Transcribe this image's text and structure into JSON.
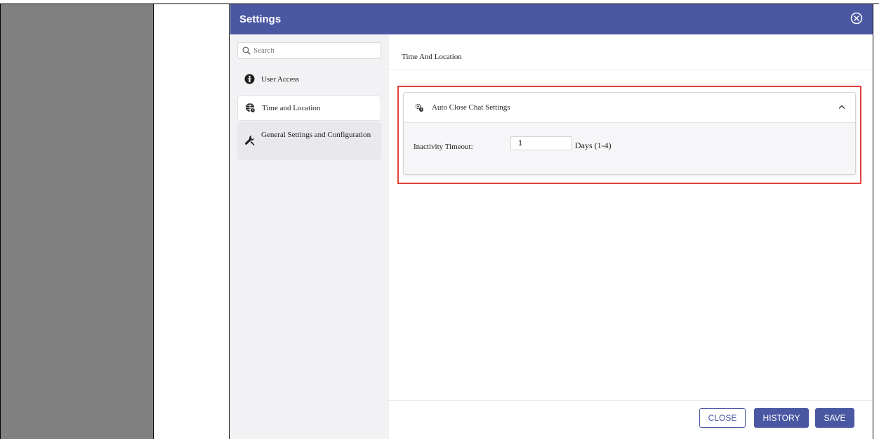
{
  "dialog": {
    "title": "Settings"
  },
  "sidebar": {
    "search_placeholder": "Search",
    "items": [
      {
        "label": "User Access",
        "icon": "user-access-icon"
      },
      {
        "label": "Time and Location",
        "icon": "globe-clock-icon"
      },
      {
        "label": "General Settings and Configuration",
        "icon": "wrench-icon"
      }
    ]
  },
  "main": {
    "section_title": "Time And Location",
    "panel": {
      "title": "Auto Close Chat Settings",
      "field_label": "Inactivity Timeout:",
      "field_value": "1",
      "field_unit": "Days (1-4)"
    }
  },
  "footer": {
    "close_label": "CLOSE",
    "history_label": "HISTORY",
    "save_label": "SAVE"
  },
  "colors": {
    "accent": "#4a57a3",
    "highlight": "#e0413a",
    "sidebar_bg": "#f2f2f4"
  }
}
